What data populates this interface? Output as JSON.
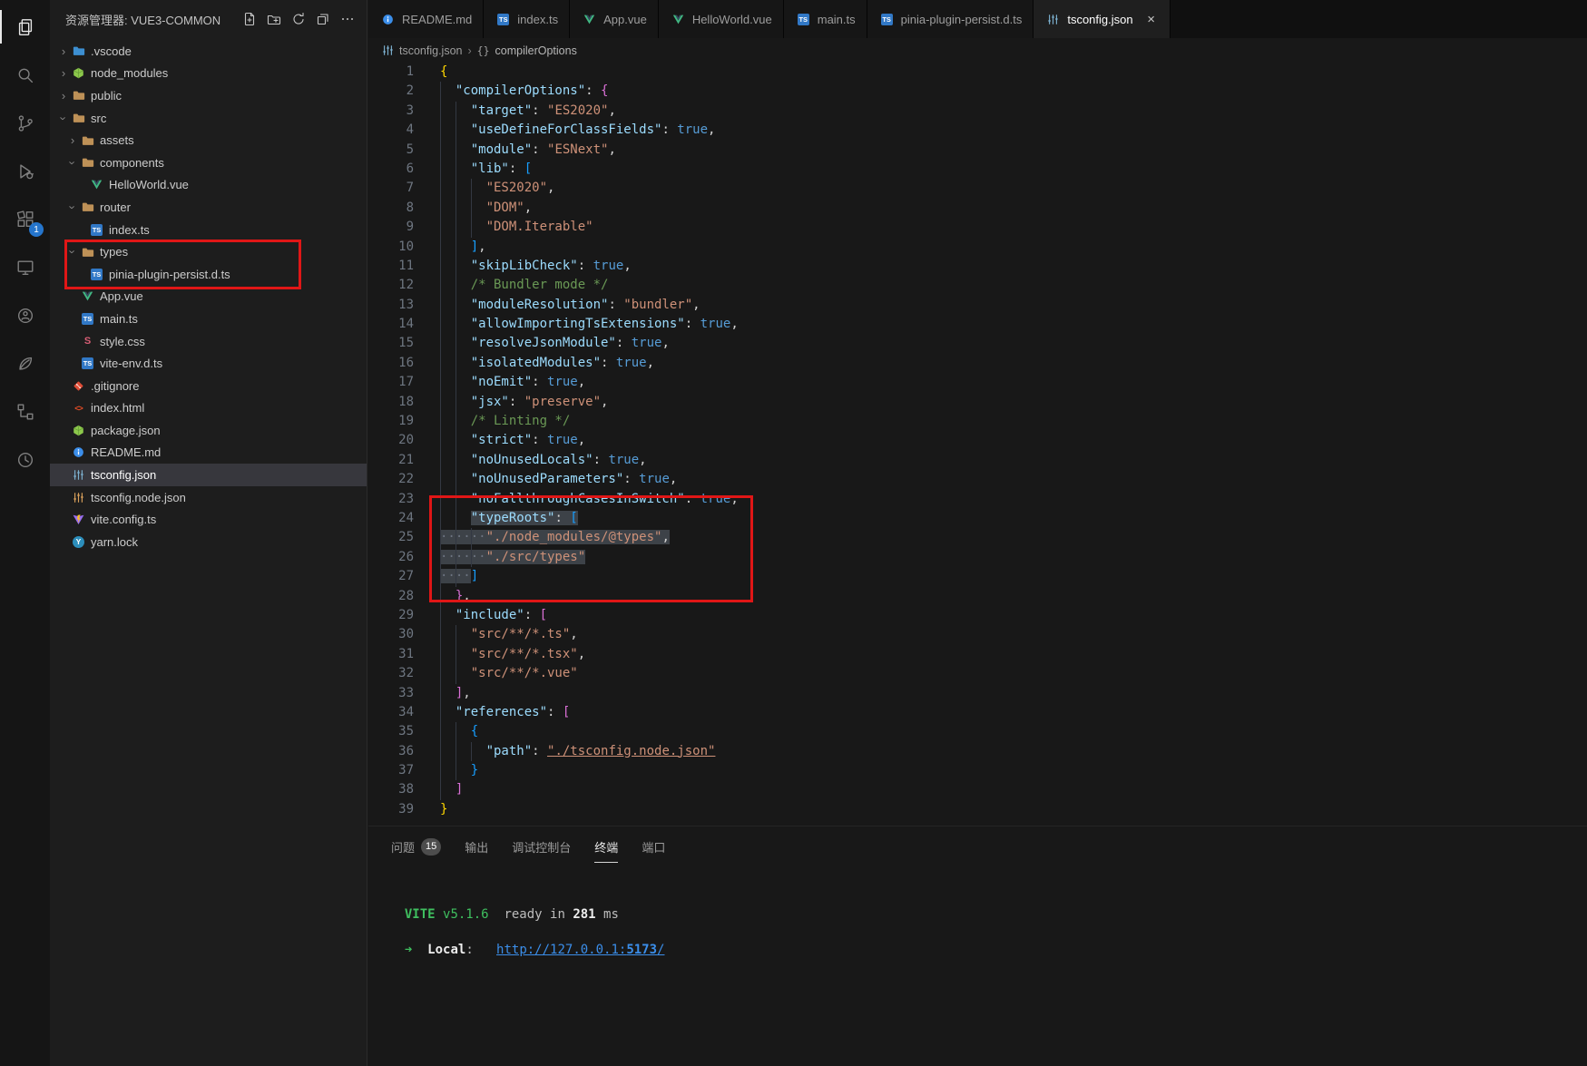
{
  "theme": {
    "accent": "#2575cc",
    "annotation-red": "#e01616",
    "selection": "#3d4248"
  },
  "activity_bar": {
    "items": [
      {
        "icon": "explorer-icon",
        "active": true
      },
      {
        "icon": "search-icon"
      },
      {
        "icon": "source-control-icon"
      },
      {
        "icon": "run-debug-icon"
      },
      {
        "icon": "extensions-icon",
        "badge": "1"
      },
      {
        "icon": "remote-explorer-icon"
      },
      {
        "icon": "live-share-icon"
      },
      {
        "icon": "testing-icon"
      },
      {
        "icon": "todo-tree-icon"
      },
      {
        "icon": "history-icon"
      }
    ]
  },
  "sidebar": {
    "title": "资源管理器: VUE3-COMMON",
    "actions": [
      "new-file",
      "new-folder",
      "refresh",
      "collapse-all",
      "more-actions"
    ],
    "tree": [
      {
        "label": ".vscode",
        "type": "folder",
        "level": 0,
        "expanded": false,
        "icon": "folder-vscode"
      },
      {
        "label": "node_modules",
        "type": "folder",
        "level": 0,
        "expanded": false,
        "icon": "node-cube"
      },
      {
        "label": "public",
        "type": "folder",
        "level": 0,
        "expanded": false,
        "icon": "folder"
      },
      {
        "label": "src",
        "type": "folder",
        "level": 0,
        "expanded": true,
        "icon": "folder"
      },
      {
        "label": "assets",
        "type": "folder",
        "level": 1,
        "expanded": false,
        "icon": "folder"
      },
      {
        "label": "components",
        "type": "folder",
        "level": 1,
        "expanded": true,
        "icon": "folder"
      },
      {
        "label": "HelloWorld.vue",
        "type": "file",
        "level": 2,
        "icon": "vue"
      },
      {
        "label": "router",
        "type": "folder",
        "level": 1,
        "expanded": true,
        "icon": "folder"
      },
      {
        "label": "index.ts",
        "type": "file",
        "level": 2,
        "icon": "ts"
      },
      {
        "label": "types",
        "type": "folder",
        "level": 1,
        "expanded": true,
        "icon": "folder"
      },
      {
        "label": "pinia-plugin-persist.d.ts",
        "type": "file",
        "level": 2,
        "icon": "ts"
      },
      {
        "label": "App.vue",
        "type": "file",
        "level": 1,
        "icon": "vue"
      },
      {
        "label": "main.ts",
        "type": "file",
        "level": 1,
        "icon": "ts"
      },
      {
        "label": "style.css",
        "type": "file",
        "level": 1,
        "icon": "css"
      },
      {
        "label": "vite-env.d.ts",
        "type": "file",
        "level": 1,
        "icon": "ts"
      },
      {
        "label": ".gitignore",
        "type": "file",
        "level": 0,
        "icon": "git"
      },
      {
        "label": "index.html",
        "type": "file",
        "level": 0,
        "icon": "html"
      },
      {
        "label": "package.json",
        "type": "file",
        "level": 0,
        "icon": "npm"
      },
      {
        "label": "README.md",
        "type": "file",
        "level": 0,
        "icon": "info"
      },
      {
        "label": "tsconfig.json",
        "type": "file",
        "level": 0,
        "icon": "sliders-blue",
        "selected": true
      },
      {
        "label": "tsconfig.node.json",
        "type": "file",
        "level": 0,
        "icon": "sliders-orange"
      },
      {
        "label": "vite.config.ts",
        "type": "file",
        "level": 0,
        "icon": "vite"
      },
      {
        "label": "yarn.lock",
        "type": "file",
        "level": 0,
        "icon": "yarn"
      }
    ]
  },
  "editor": {
    "tabs": [
      {
        "label": "README.md",
        "icon": "info"
      },
      {
        "label": "index.ts",
        "icon": "ts"
      },
      {
        "label": "App.vue",
        "icon": "vue"
      },
      {
        "label": "HelloWorld.vue",
        "icon": "vue"
      },
      {
        "label": "main.ts",
        "icon": "ts"
      },
      {
        "label": "pinia-plugin-persist.d.ts",
        "icon": "ts"
      },
      {
        "label": "tsconfig.json",
        "icon": "sliders-blue",
        "active": true,
        "close": "×"
      }
    ],
    "breadcrumb": {
      "file": "tsconfig.json",
      "symbol_prefix": "{}",
      "symbol": "compilerOptions"
    },
    "code": {
      "lines": [
        {
          "n": 1,
          "ind": 0,
          "tok": [
            {
              "t": "{",
              "c": "g1"
            }
          ]
        },
        {
          "n": 2,
          "ind": 2,
          "tok": [
            {
              "t": "  "
            },
            {
              "t": "\"compilerOptions\"",
              "c": "k"
            },
            {
              "t": ": "
            },
            {
              "t": "{",
              "c": "g2"
            }
          ]
        },
        {
          "n": 3,
          "ind": 4,
          "tok": [
            {
              "t": "    "
            },
            {
              "t": "\"target\"",
              "c": "k"
            },
            {
              "t": ": "
            },
            {
              "t": "\"ES2020\"",
              "c": "s"
            },
            {
              "t": ","
            }
          ]
        },
        {
          "n": 4,
          "ind": 4,
          "tok": [
            {
              "t": "    "
            },
            {
              "t": "\"useDefineForClassFields\"",
              "c": "k"
            },
            {
              "t": ": "
            },
            {
              "t": "true",
              "c": "b"
            },
            {
              "t": ","
            }
          ]
        },
        {
          "n": 5,
          "ind": 4,
          "tok": [
            {
              "t": "    "
            },
            {
              "t": "\"module\"",
              "c": "k"
            },
            {
              "t": ": "
            },
            {
              "t": "\"ESNext\"",
              "c": "s"
            },
            {
              "t": ","
            }
          ]
        },
        {
          "n": 6,
          "ind": 4,
          "tok": [
            {
              "t": "    "
            },
            {
              "t": "\"lib\"",
              "c": "k"
            },
            {
              "t": ": "
            },
            {
              "t": "[",
              "c": "g3"
            }
          ]
        },
        {
          "n": 7,
          "ind": 6,
          "tok": [
            {
              "t": "      "
            },
            {
              "t": "\"ES2020\"",
              "c": "s"
            },
            {
              "t": ","
            }
          ]
        },
        {
          "n": 8,
          "ind": 6,
          "tok": [
            {
              "t": "      "
            },
            {
              "t": "\"DOM\"",
              "c": "s"
            },
            {
              "t": ","
            }
          ]
        },
        {
          "n": 9,
          "ind": 6,
          "tok": [
            {
              "t": "      "
            },
            {
              "t": "\"DOM.Iterable\"",
              "c": "s"
            }
          ]
        },
        {
          "n": 10,
          "ind": 4,
          "tok": [
            {
              "t": "    "
            },
            {
              "t": "]",
              "c": "g3"
            },
            {
              "t": ","
            }
          ]
        },
        {
          "n": 11,
          "ind": 4,
          "tok": [
            {
              "t": "    "
            },
            {
              "t": "\"skipLibCheck\"",
              "c": "k"
            },
            {
              "t": ": "
            },
            {
              "t": "true",
              "c": "b"
            },
            {
              "t": ","
            }
          ]
        },
        {
          "n": 12,
          "ind": 4,
          "tok": [
            {
              "t": "    "
            },
            {
              "t": "/* Bundler mode */",
              "c": "c"
            }
          ]
        },
        {
          "n": 13,
          "ind": 4,
          "tok": [
            {
              "t": "    "
            },
            {
              "t": "\"moduleResolution\"",
              "c": "k"
            },
            {
              "t": ": "
            },
            {
              "t": "\"bundler\"",
              "c": "s"
            },
            {
              "t": ","
            }
          ]
        },
        {
          "n": 14,
          "ind": 4,
          "tok": [
            {
              "t": "    "
            },
            {
              "t": "\"allowImportingTsExtensions\"",
              "c": "k"
            },
            {
              "t": ": "
            },
            {
              "t": "true",
              "c": "b"
            },
            {
              "t": ","
            }
          ]
        },
        {
          "n": 15,
          "ind": 4,
          "tok": [
            {
              "t": "    "
            },
            {
              "t": "\"resolveJsonModule\"",
              "c": "k"
            },
            {
              "t": ": "
            },
            {
              "t": "true",
              "c": "b"
            },
            {
              "t": ","
            }
          ]
        },
        {
          "n": 16,
          "ind": 4,
          "tok": [
            {
              "t": "    "
            },
            {
              "t": "\"isolatedModules\"",
              "c": "k"
            },
            {
              "t": ": "
            },
            {
              "t": "true",
              "c": "b"
            },
            {
              "t": ","
            }
          ]
        },
        {
          "n": 17,
          "ind": 4,
          "tok": [
            {
              "t": "    "
            },
            {
              "t": "\"noEmit\"",
              "c": "k"
            },
            {
              "t": ": "
            },
            {
              "t": "true",
              "c": "b"
            },
            {
              "t": ","
            }
          ]
        },
        {
          "n": 18,
          "ind": 4,
          "tok": [
            {
              "t": "    "
            },
            {
              "t": "\"jsx\"",
              "c": "k"
            },
            {
              "t": ": "
            },
            {
              "t": "\"preserve\"",
              "c": "s"
            },
            {
              "t": ","
            }
          ]
        },
        {
          "n": 19,
          "ind": 4,
          "tok": [
            {
              "t": "    "
            },
            {
              "t": "/* Linting */",
              "c": "c"
            }
          ]
        },
        {
          "n": 20,
          "ind": 4,
          "tok": [
            {
              "t": "    "
            },
            {
              "t": "\"strict\"",
              "c": "k"
            },
            {
              "t": ": "
            },
            {
              "t": "true",
              "c": "b"
            },
            {
              "t": ","
            }
          ]
        },
        {
          "n": 21,
          "ind": 4,
          "tok": [
            {
              "t": "    "
            },
            {
              "t": "\"noUnusedLocals\"",
              "c": "k"
            },
            {
              "t": ": "
            },
            {
              "t": "true",
              "c": "b"
            },
            {
              "t": ","
            }
          ]
        },
        {
          "n": 22,
          "ind": 4,
          "tok": [
            {
              "t": "    "
            },
            {
              "t": "\"noUnusedParameters\"",
              "c": "k"
            },
            {
              "t": ": "
            },
            {
              "t": "true",
              "c": "b"
            },
            {
              "t": ","
            }
          ]
        },
        {
          "n": 23,
          "ind": 4,
          "tok": [
            {
              "t": "    "
            },
            {
              "t": "\"noFallthroughCasesInSwitch\"",
              "c": "k"
            },
            {
              "t": ": "
            },
            {
              "t": "true",
              "c": "b"
            },
            {
              "t": ","
            }
          ]
        },
        {
          "n": 24,
          "ind": 4,
          "tok": [
            {
              "t": "    "
            },
            {
              "t": "\"typeRoots\"",
              "c": "k",
              "sel": true
            },
            {
              "t": ": ",
              "sel": true
            },
            {
              "t": "[",
              "c": "g3",
              "sel": true
            }
          ]
        },
        {
          "n": 25,
          "ind": 6,
          "tok": [
            {
              "t": "······",
              "c": "w",
              "sel": true
            },
            {
              "t": "\"./node_modules/@types\"",
              "c": "s",
              "sel": true
            },
            {
              "t": ",",
              "sel": true
            }
          ]
        },
        {
          "n": 26,
          "ind": 6,
          "tok": [
            {
              "t": "······",
              "c": "w",
              "sel": true
            },
            {
              "t": "\"./src/types\"",
              "c": "s",
              "sel": true
            }
          ]
        },
        {
          "n": 27,
          "ind": 4,
          "tok": [
            {
              "t": "····",
              "c": "w",
              "sel": true
            },
            {
              "t": "]",
              "c": "g3"
            }
          ]
        },
        {
          "n": 28,
          "ind": 2,
          "tok": [
            {
              "t": "  "
            },
            {
              "t": "}",
              "c": "g2"
            },
            {
              "t": ","
            }
          ]
        },
        {
          "n": 29,
          "ind": 2,
          "tok": [
            {
              "t": "  "
            },
            {
              "t": "\"include\"",
              "c": "k"
            },
            {
              "t": ": "
            },
            {
              "t": "[",
              "c": "g2"
            }
          ]
        },
        {
          "n": 30,
          "ind": 4,
          "tok": [
            {
              "t": "    "
            },
            {
              "t": "\"src/**/*.ts\"",
              "c": "s"
            },
            {
              "t": ","
            }
          ]
        },
        {
          "n": 31,
          "ind": 4,
          "tok": [
            {
              "t": "    "
            },
            {
              "t": "\"src/**/*.tsx\"",
              "c": "s"
            },
            {
              "t": ","
            }
          ]
        },
        {
          "n": 32,
          "ind": 4,
          "tok": [
            {
              "t": "    "
            },
            {
              "t": "\"src/**/*.vue\"",
              "c": "s"
            }
          ]
        },
        {
          "n": 33,
          "ind": 2,
          "tok": [
            {
              "t": "  "
            },
            {
              "t": "]",
              "c": "g2"
            },
            {
              "t": ","
            }
          ]
        },
        {
          "n": 34,
          "ind": 2,
          "tok": [
            {
              "t": "  "
            },
            {
              "t": "\"references\"",
              "c": "k"
            },
            {
              "t": ": "
            },
            {
              "t": "[",
              "c": "g2"
            }
          ]
        },
        {
          "n": 35,
          "ind": 4,
          "tok": [
            {
              "t": "    "
            },
            {
              "t": "{",
              "c": "g3"
            }
          ]
        },
        {
          "n": 36,
          "ind": 6,
          "tok": [
            {
              "t": "      "
            },
            {
              "t": "\"path\"",
              "c": "k"
            },
            {
              "t": ": "
            },
            {
              "t": "\"./tsconfig.node.json\"",
              "c": "l"
            }
          ]
        },
        {
          "n": 37,
          "ind": 4,
          "tok": [
            {
              "t": "    "
            },
            {
              "t": "}",
              "c": "g3"
            }
          ]
        },
        {
          "n": 38,
          "ind": 2,
          "tok": [
            {
              "t": "  "
            },
            {
              "t": "]",
              "c": "g2"
            }
          ]
        },
        {
          "n": 39,
          "ind": 0,
          "tok": [
            {
              "t": "}",
              "c": "g1"
            }
          ]
        }
      ]
    }
  },
  "panel": {
    "tabs": [
      {
        "label": "问题",
        "badge": "15"
      },
      {
        "label": "输出"
      },
      {
        "label": "调试控制台"
      },
      {
        "label": "终端",
        "active": true
      },
      {
        "label": "端口"
      }
    ],
    "terminal": {
      "lines": [
        {
          "seg": []
        },
        {
          "seg": [
            {
              "t": "  "
            },
            {
              "t": "VITE",
              "c": "g b"
            },
            {
              "t": " "
            },
            {
              "t": "v5.1.6",
              "c": "g"
            },
            {
              "t": "  ready in ",
              "c": "d"
            },
            {
              "t": "281",
              "c": "w b"
            },
            {
              "t": " ms",
              "c": "d"
            }
          ]
        },
        {
          "seg": []
        },
        {
          "seg": [
            {
              "t": "  "
            },
            {
              "t": "➜",
              "c": "g"
            },
            {
              "t": "  "
            },
            {
              "t": "Local",
              "c": "w b"
            },
            {
              "t": ":   ",
              "c": "d"
            },
            {
              "t": "http://127.0.0.1:",
              "c": "c u"
            },
            {
              "t": "5173",
              "c": "c u b"
            },
            {
              "t": "/",
              "c": "c u"
            }
          ]
        }
      ]
    }
  },
  "annotations": [
    {
      "name": "annotation-box-sidebar-types"
    },
    {
      "name": "annotation-box-editor-typeroots"
    }
  ]
}
